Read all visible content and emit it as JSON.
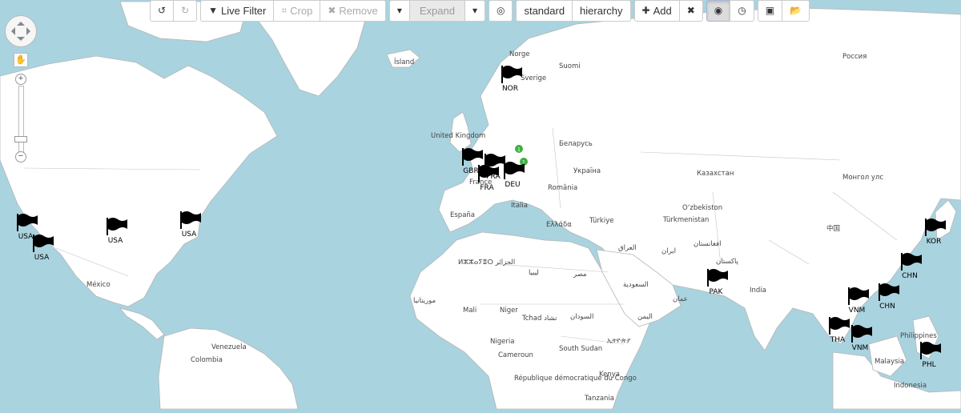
{
  "toolbar": {
    "undo": "undo-icon",
    "redo": "redo-icon",
    "live_filter": "Live Filter",
    "crop": "Crop",
    "remove": "Remove",
    "expand": "Expand",
    "standard": "standard",
    "hierarchy": "hierarchy",
    "add": "Add"
  },
  "map_labels": [
    "Ísland",
    "Norge",
    "Sverige",
    "Suomi",
    "Россия",
    "United Kingdom",
    "Беларусь",
    "Україна",
    "France",
    "România",
    "Italia",
    "España",
    "Türkiye",
    "Ελλάδα",
    "Казахстан",
    "O‘zbekiston",
    "Türkmenistan",
    "Монгол улс",
    "中国",
    "العراق",
    "ایران",
    "افغانستان",
    "پاکستان",
    "India",
    "ⵍⵣⵣⴰⵢⴻⵔ الجزائر",
    "ليبيا",
    "مصر",
    "موريتانيا",
    "Mali",
    "Niger",
    "Tchad تشاد",
    "السودان",
    "السعودية",
    "اليمن",
    "عمان",
    "Nigeria",
    "Cameroun",
    "South Sudan",
    "ኢትዮጵያ",
    "Kenya",
    "République démocratique du Congo",
    "Tanzania",
    "México",
    "Venezuela",
    "Colombia",
    "Philippines",
    "Malaysia",
    "Indonesia"
  ],
  "markers": [
    {
      "label": "NOR"
    },
    {
      "label": "GBR"
    },
    {
      "label": "FRA"
    },
    {
      "label": "FRA"
    },
    {
      "label": "DEU"
    },
    {
      "label": "USA"
    },
    {
      "label": "USA"
    },
    {
      "label": "USA"
    },
    {
      "label": "USA"
    },
    {
      "label": "KOR"
    },
    {
      "label": "CHN"
    },
    {
      "label": "CHN"
    },
    {
      "label": "PAK"
    },
    {
      "label": "VNM"
    },
    {
      "label": "THA"
    },
    {
      "label": "VNM"
    },
    {
      "label": "PHL"
    }
  ],
  "clusters": [
    "1",
    "1"
  ],
  "colors": {
    "ocean": "#a9d3df",
    "land": "#ffffff",
    "border": "#b6b6b6",
    "cluster": "#3fae3f"
  }
}
